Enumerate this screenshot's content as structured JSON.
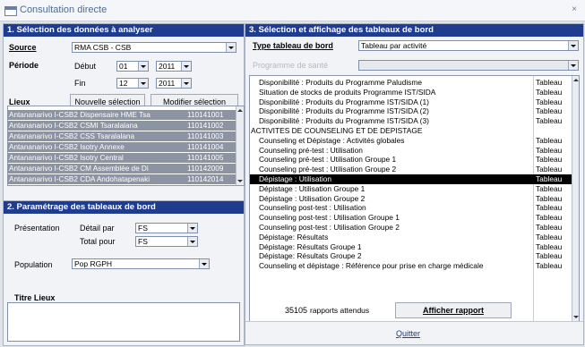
{
  "window": {
    "title": "Consultation directe",
    "close_icon": "×"
  },
  "section1": {
    "header": "1. Sélection des données à analyser",
    "source_label": "Source",
    "source_value": "RMA CSB - CSB",
    "periode_label": "Période",
    "debut_label": "Début",
    "debut_month": "01",
    "debut_year": "2011",
    "fin_label": "Fin",
    "fin_month": "12",
    "fin_year": "2011",
    "lieux_label": "Lieux",
    "nouvelle_selection": "Nouvelle sélection",
    "modifier_selection": "Modifier sélection",
    "lieux": [
      {
        "name": "Antananarivo I-CSB2 Dispensaire HME Tsa",
        "code": "110141001"
      },
      {
        "name": "Antananarivo I-CSB2 CSMI Tsaralalana",
        "code": "110141002"
      },
      {
        "name": "Antananarivo I-CSB2 CSS Tsaralalana",
        "code": "110141003"
      },
      {
        "name": "Antananarivo I-CSB2 Isotry Annexe",
        "code": "110141004"
      },
      {
        "name": "Antananarivo I-CSB2 Isotry Central",
        "code": "110141005"
      },
      {
        "name": "Antananarivo I-CSB2 CM Assemblée de Di",
        "code": "110142009"
      },
      {
        "name": "Antananarivo I-CSB2 CDA Andohatapenaki",
        "code": "110142014"
      }
    ]
  },
  "section2": {
    "header": "2. Paramétrage des tableaux de bord",
    "presentation_label": "Présentation",
    "detail_par_label": "Détail par",
    "detail_par_value": "FS",
    "total_pour_label": "Total pour",
    "total_pour_value": "FS",
    "population_label": "Population",
    "population_value": "Pop RGPH",
    "titre_lieux_label": "Titre Lieux"
  },
  "section3": {
    "header": "3. Sélection et affichage des tableaux de bord",
    "type_label": "Type tableau de bord",
    "type_value": "Tableau par activité",
    "programme_label": "Programme de santé",
    "programme_value": "",
    "items": [
      {
        "name": "Disponibilité : Produits du Programme Paludisme",
        "type": "Tableau"
      },
      {
        "name": "Situation de stocks de produits Programme IST/SIDA",
        "type": "Tableau"
      },
      {
        "name": "Disponibilité : Produits du Programme IST/SIDA (1)",
        "type": "Tableau"
      },
      {
        "name": "Disponibilité : Produits du Programme IST/SIDA (2)",
        "type": "Tableau"
      },
      {
        "name": "Disponibilité : Produits du Programme IST/SIDA (3)",
        "type": "Tableau"
      },
      {
        "name": "ACTIVITES DE COUNSELING ET DE DEPISTAGE",
        "type": ""
      },
      {
        "name": "Counseling et Dépistage : Activités globales",
        "type": "Tableau"
      },
      {
        "name": "Counseling pré-test : Utilisation",
        "type": "Tableau"
      },
      {
        "name": "Counseling pré-test : Utilisation Groupe 1",
        "type": "Tableau"
      },
      {
        "name": "Counseling pré-test : Utilisation Groupe 2",
        "type": "Tableau"
      },
      {
        "name": "Dépistage : Utilisation",
        "type": "Tableau",
        "selected": true
      },
      {
        "name": "Dépistage : Utilisation Groupe 1",
        "type": "Tableau"
      },
      {
        "name": "Dépistage : Utilisation Groupe 2",
        "type": "Tableau"
      },
      {
        "name": "Counseling post-test : Utilisation",
        "type": "Tableau"
      },
      {
        "name": "Counseling post-test : Utilisation Groupe 1",
        "type": "Tableau"
      },
      {
        "name": "Counseling post-test : Utilisation Groupe 2",
        "type": "Tableau"
      },
      {
        "name": "Dépistage: Résultats",
        "type": "Tableau"
      },
      {
        "name": "Dépistage: Résultats Groupe 1",
        "type": "Tableau"
      },
      {
        "name": "Dépistage: Résultats Groupe 2",
        "type": "Tableau"
      },
      {
        "name": "Counseling et dépistage : Référence pour prise en charge médicale",
        "type": "Tableau"
      }
    ],
    "rapports_count": "35105",
    "rapports_label": "rapports attendus",
    "afficher_button": "Afficher rapport",
    "quitter_button": "Quitter"
  },
  "colors": {
    "header_bg": "#1f3c8f",
    "lieux_row_bg": "#8c93a3",
    "selected_row_bg": "#000000"
  }
}
